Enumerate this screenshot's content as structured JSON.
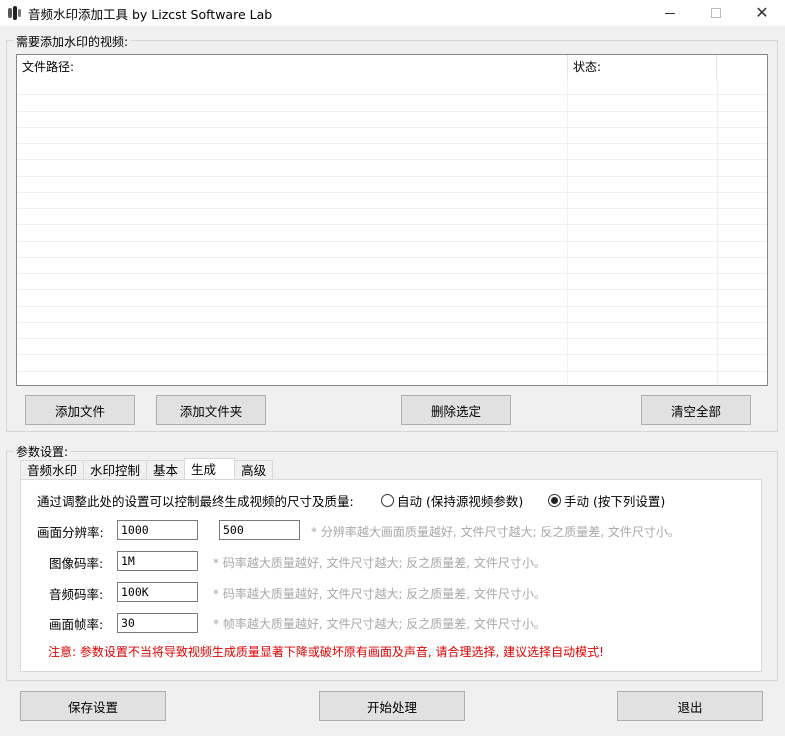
{
  "window": {
    "title": "音频水印添加工具  by Lizcst Software Lab",
    "close_glyph": "✕"
  },
  "video_list": {
    "group_label": "需要添加水印的视频:",
    "columns": [
      "文件路径:",
      "状态:"
    ],
    "rows": []
  },
  "list_buttons": {
    "add_file": "添加文件",
    "add_folder": "添加文件夹",
    "delete_selected": "删除选定",
    "clear_all": "清空全部"
  },
  "params": {
    "group_label": "参数设置:",
    "tabs": [
      "音频水印",
      "水印控制",
      "基本",
      "生成",
      "高级"
    ],
    "active_tab": "生成",
    "description": "通过调整此处的设置可以控制最终生成视频的尺寸及质量:",
    "radio_auto": "自动 (保持源视频参数)",
    "radio_manual": "手动 (按下列设置)",
    "selected_mode": "manual",
    "resolution_label": "画面分辨率:",
    "resolution_width": "1000",
    "resolution_height": "500",
    "resolution_hint": "* 分辨率越大画面质量越好, 文件尺寸越大; 反之质量差, 文件尺寸小。",
    "video_bitrate_label": "图像码率:",
    "video_bitrate": "1M",
    "video_bitrate_hint": "* 码率越大质量越好, 文件尺寸越大; 反之质量差, 文件尺寸小。",
    "audio_bitrate_label": "音频码率:",
    "audio_bitrate": "100K",
    "audio_bitrate_hint": "* 码率越大质量越好, 文件尺寸越大; 反之质量差, 文件尺寸小。",
    "framerate_label": "画面帧率:",
    "framerate": "30",
    "framerate_hint": "* 帧率越大质量越好, 文件尺寸越大; 反之质量差, 文件尺寸小。",
    "warning": "注意: 参数设置不当将导致视频生成质量显著下降或破坏原有画面及声音, 请合理选择, 建议选择自动模式!"
  },
  "bottom_buttons": {
    "save": "保存设置",
    "start": "开始处理",
    "exit": "退出"
  },
  "colors": {
    "warning": "#e00000",
    "hint": "#a8a8a8",
    "window_bg": "#f0f0f0"
  }
}
